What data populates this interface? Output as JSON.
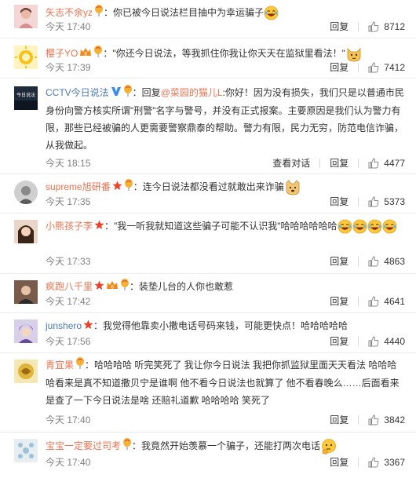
{
  "actions": {
    "reply": "回复",
    "view_conversation": "查看对话"
  },
  "comments": [
    {
      "user": "矢志不余yz",
      "text": "：你已被今日说法栏目抽中为幸运骗子",
      "time": "今天 17:40",
      "likes": "8712"
    },
    {
      "user": "樱子YO",
      "text": "：\"你还今日说法，等我抓住你我让你天天在监狱里看法！\"",
      "time": "今天 17:39",
      "likes": "7412"
    },
    {
      "user": "CCTV今日说法",
      "reply_prefix": "：回复",
      "reply_to": "@菜园的猫儿L",
      "text": ":你好！因为没有损失，我们只是以普通市民身份向警方核实所谓\"刑警\"名字与警号，并没有正式报案。主要原因是我们认为警力有限，那些已经被骗的人更需要警察鼎泰的帮助。警力有限，民力无穷，防范电信诈骗，从我做起。",
      "time": "今天 18:15",
      "likes": "4477",
      "avatar_text": "今日说法"
    },
    {
      "user": "supreme旭研番",
      "text": "：连今日说法都没看过就敢出来诈骗",
      "time": "今天 17:35",
      "likes": "5373"
    },
    {
      "user": "小熊孩子李",
      "text": "：\"我一听我就知道这些骗子可能不认识我\"哈哈哈哈哈哈",
      "time": "今天 17:33",
      "likes": "4863"
    },
    {
      "user": "疯跑八千里",
      "text": "：装垫儿台的人你也敢惹",
      "time": "今天 17:42",
      "likes": "4641"
    },
    {
      "user": "junshero",
      "text": "：我觉得他靠卖小撒电话号码来钱，可能更快点！哈哈哈哈哈",
      "time": "今天 17:56",
      "likes": "4440"
    },
    {
      "user": "青宜果",
      "text": "：哈哈哈哈 听完笑死了 我让你今日说法 我把你抓监狱里面天天看法 哈哈哈哈看来是真不知道撒贝宁是谁啊 他不看今日说法也就算了 他不看春晚么……后面看来是查了一下今日说法是啥 还赔礼道歉 哈哈哈哈 笑死了",
      "time": "今天 17:40",
      "likes": "3842"
    },
    {
      "user": "宝宝一定要过司考",
      "text": "：我竟然开始羡慕一个骗子，还能打两次电话",
      "time": "今天 17:40",
      "likes": "3367"
    }
  ],
  "colors": {
    "username": "#eb7350",
    "official_username": "#4b79b8",
    "time": "#808080",
    "text": "#333333"
  }
}
